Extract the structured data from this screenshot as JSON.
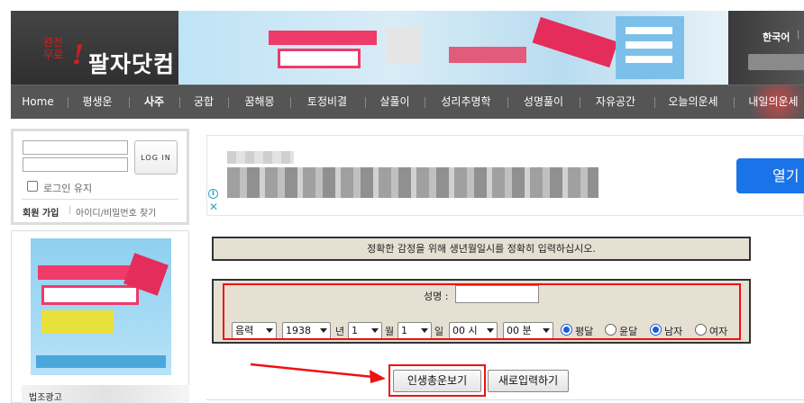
{
  "logo": {
    "small_line1": "완전",
    "small_line2": "무료",
    "bang": "!",
    "main": "팔자닷컴"
  },
  "header": {
    "language": "한국어",
    "lang_sep": "|"
  },
  "nav": {
    "items": [
      {
        "label": "Home",
        "active": false
      },
      {
        "label": "평생운",
        "active": false
      },
      {
        "label": "사주",
        "active": true
      },
      {
        "label": "궁합",
        "active": false
      },
      {
        "label": "꿈해몽",
        "active": false
      },
      {
        "label": "토정비결",
        "active": false
      },
      {
        "label": "살풀이",
        "active": false
      },
      {
        "label": "성리추명학",
        "active": false
      },
      {
        "label": "성명풀이",
        "active": false
      },
      {
        "label": "자유공간",
        "active": false
      },
      {
        "label": "오늘의운세",
        "active": false
      },
      {
        "label": "내일의운세",
        "active": false
      }
    ]
  },
  "login": {
    "button": "LOG IN",
    "keep_login": "로그인 유지",
    "join": "회원 가입",
    "join_sep": "|",
    "find": "아이디/비밀번호 찾기"
  },
  "side_ad": {
    "caption": "법조광고"
  },
  "ad": {
    "open_button": "열기",
    "info_icon": "i",
    "close_icon": "✕"
  },
  "form": {
    "notice": "정확한 감정을 위해 생년월일시를 정확히 입력하십시오.",
    "name_label": "성명 :",
    "name_value": "",
    "calendar": "음력",
    "year": "1938",
    "year_unit": "년",
    "month": "1",
    "month_unit": "월",
    "day": "1",
    "day_unit": "일",
    "hour": "00 시",
    "minute": "00 분",
    "leap_normal": "평달",
    "leap_yun": "윤달",
    "male": "남자",
    "female": "여자",
    "selected_leap": "평달",
    "selected_gender": "남자",
    "submit": "인생총운보기",
    "reset": "새로입력하기"
  },
  "colors": {
    "annotation_red": "#ee1111",
    "nav_bg": "#555555",
    "form_bg": "#e6e0d3",
    "ad_button": "#1a73e8"
  }
}
